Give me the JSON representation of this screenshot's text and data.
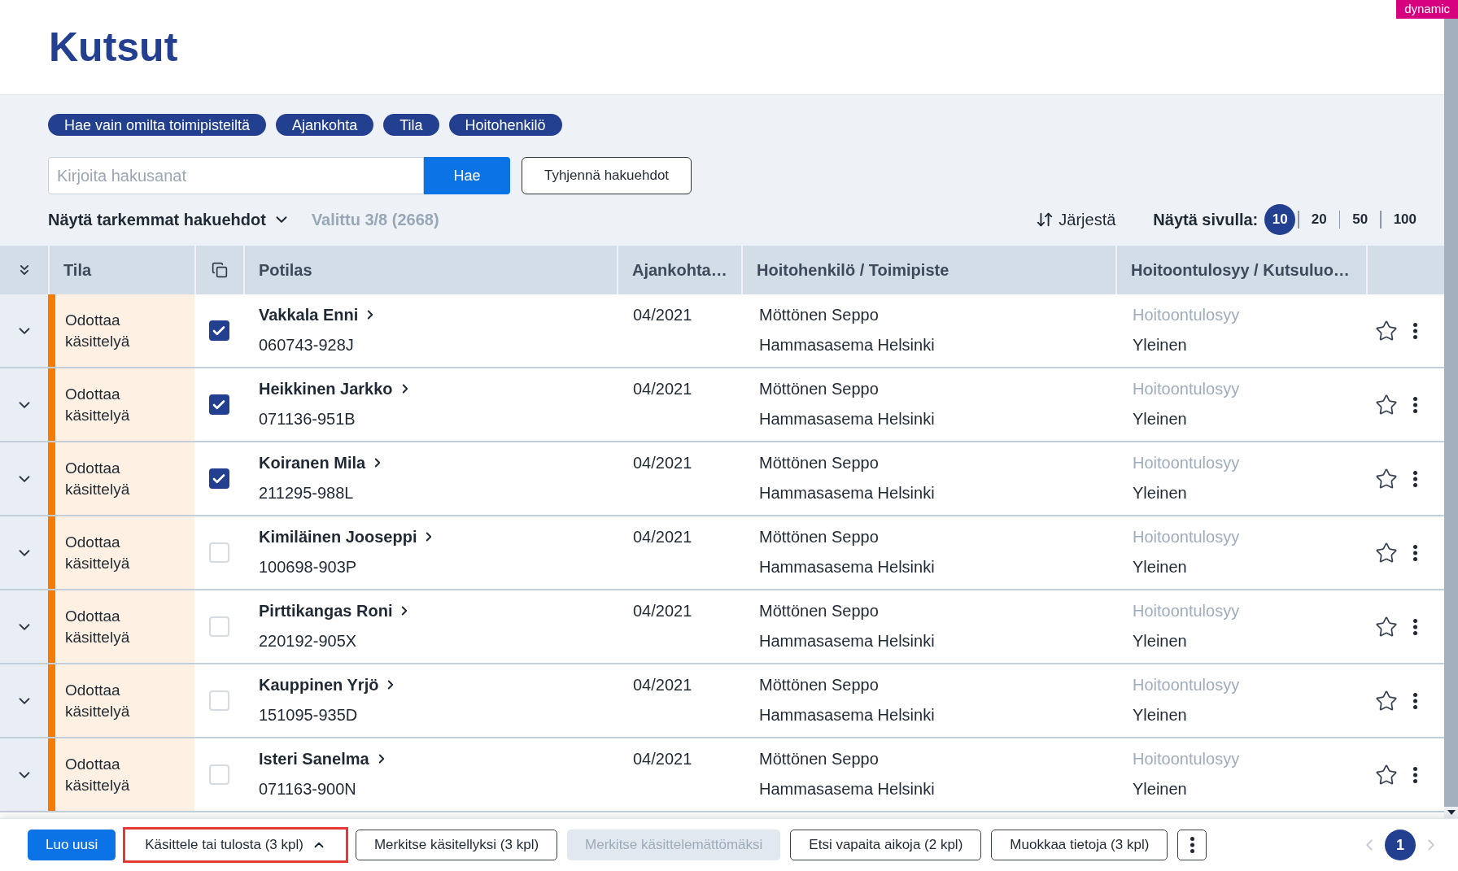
{
  "badge": "dynamic",
  "title": "Kutsut",
  "filter_chips": [
    {
      "label": "Hae vain omilta toimipisteiltä"
    },
    {
      "label": "Ajankohta"
    },
    {
      "label": "Tila"
    },
    {
      "label": "Hoitohenkilö"
    }
  ],
  "search": {
    "placeholder": "Kirjoita hakusanat",
    "button": "Hae",
    "clear_button": "Tyhjennä hakuehdot"
  },
  "advanced_toggle": {
    "label": "Näytä tarkemmat hakuehdot",
    "expanded": false
  },
  "selection_summary": "Valittu 3/8 (2668)",
  "sort_button": "Järjestä",
  "page_size": {
    "label": "Näytä sivulla:",
    "options": [
      {
        "label": "10",
        "selected": true
      },
      {
        "label": "20",
        "selected": false
      },
      {
        "label": "50",
        "selected": false
      },
      {
        "label": "100",
        "selected": false
      }
    ]
  },
  "table": {
    "columns": [
      {
        "label": "Tila"
      },
      {
        "label": "Potilas"
      },
      {
        "label": "Ajankohta…"
      },
      {
        "label": "Hoitohenkilö / Toimipiste"
      },
      {
        "label": "Hoitoontulosyy / Kutsuluo…"
      }
    ],
    "rows": [
      {
        "expanded": false,
        "status": "Odottaa käsittelyä",
        "checked": true,
        "patient": "Vakkala Enni",
        "id": "060743-928J",
        "date": "04/2021",
        "staff": "Möttönen Seppo",
        "office": "Hammasasema Helsinki",
        "reason_label": "Hoitoontulosyy",
        "reason": "Yleinen",
        "favorite": false
      },
      {
        "expanded": false,
        "status": "Odottaa käsittelyä",
        "checked": true,
        "patient": "Heikkinen Jarkko",
        "id": "071136-951B",
        "date": "04/2021",
        "staff": "Möttönen Seppo",
        "office": "Hammasasema Helsinki",
        "reason_label": "Hoitoontulosyy",
        "reason": "Yleinen",
        "favorite": false
      },
      {
        "expanded": false,
        "status": "Odottaa käsittelyä",
        "checked": true,
        "patient": "Koiranen Mila",
        "id": "211295-988L",
        "date": "04/2021",
        "staff": "Möttönen Seppo",
        "office": "Hammasasema Helsinki",
        "reason_label": "Hoitoontulosyy",
        "reason": "Yleinen",
        "favorite": false
      },
      {
        "expanded": false,
        "status": "Odottaa käsittelyä",
        "checked": false,
        "patient": "Kimiläinen Jooseppi",
        "id": "100698-903P",
        "date": "04/2021",
        "staff": "Möttönen Seppo",
        "office": "Hammasasema Helsinki",
        "reason_label": "Hoitoontulosyy",
        "reason": "Yleinen",
        "favorite": false
      },
      {
        "expanded": false,
        "status": "Odottaa käsittelyä",
        "checked": false,
        "patient": "Pirttikangas Roni",
        "id": "220192-905X",
        "date": "04/2021",
        "staff": "Möttönen Seppo",
        "office": "Hammasasema Helsinki",
        "reason_label": "Hoitoontulosyy",
        "reason": "Yleinen",
        "favorite": false
      },
      {
        "expanded": false,
        "status": "Odottaa käsittelyä",
        "checked": false,
        "patient": "Kauppinen Yrjö",
        "id": "151095-935D",
        "date": "04/2021",
        "staff": "Möttönen Seppo",
        "office": "Hammasasema Helsinki",
        "reason_label": "Hoitoontulosyy",
        "reason": "Yleinen",
        "favorite": false
      },
      {
        "expanded": false,
        "status": "Odottaa käsittelyä",
        "checked": false,
        "patient": "Isteri Sanelma",
        "id": "071163-900N",
        "date": "04/2021",
        "staff": "Möttönen Seppo",
        "office": "Hammasasema Helsinki",
        "reason_label": "Hoitoontulosyy",
        "reason": "Yleinen",
        "favorite": false
      }
    ]
  },
  "toolbar": {
    "buttons": [
      {
        "label": "Luo uusi",
        "kind": "primary",
        "disabled": false,
        "highlighted": false
      },
      {
        "label": "Käsittele tai tulosta (3 kpl)",
        "kind": "menu",
        "disabled": false,
        "highlighted": true
      },
      {
        "label": "Merkitse käsitellyksi (3 kpl)",
        "kind": "outline",
        "disabled": false,
        "highlighted": false
      },
      {
        "label": "Merkitse käsittelemättömäksi",
        "kind": "outline",
        "disabled": true,
        "highlighted": false
      },
      {
        "label": "Etsi vapaita aikoja (2 kpl)",
        "kind": "outline",
        "disabled": false,
        "highlighted": false
      },
      {
        "label": "Muokkaa tietoja (3 kpl)",
        "kind": "outline",
        "disabled": false,
        "highlighted": false
      }
    ]
  },
  "pagination": {
    "pages": [
      {
        "label": "1",
        "selected": true
      }
    ]
  }
}
